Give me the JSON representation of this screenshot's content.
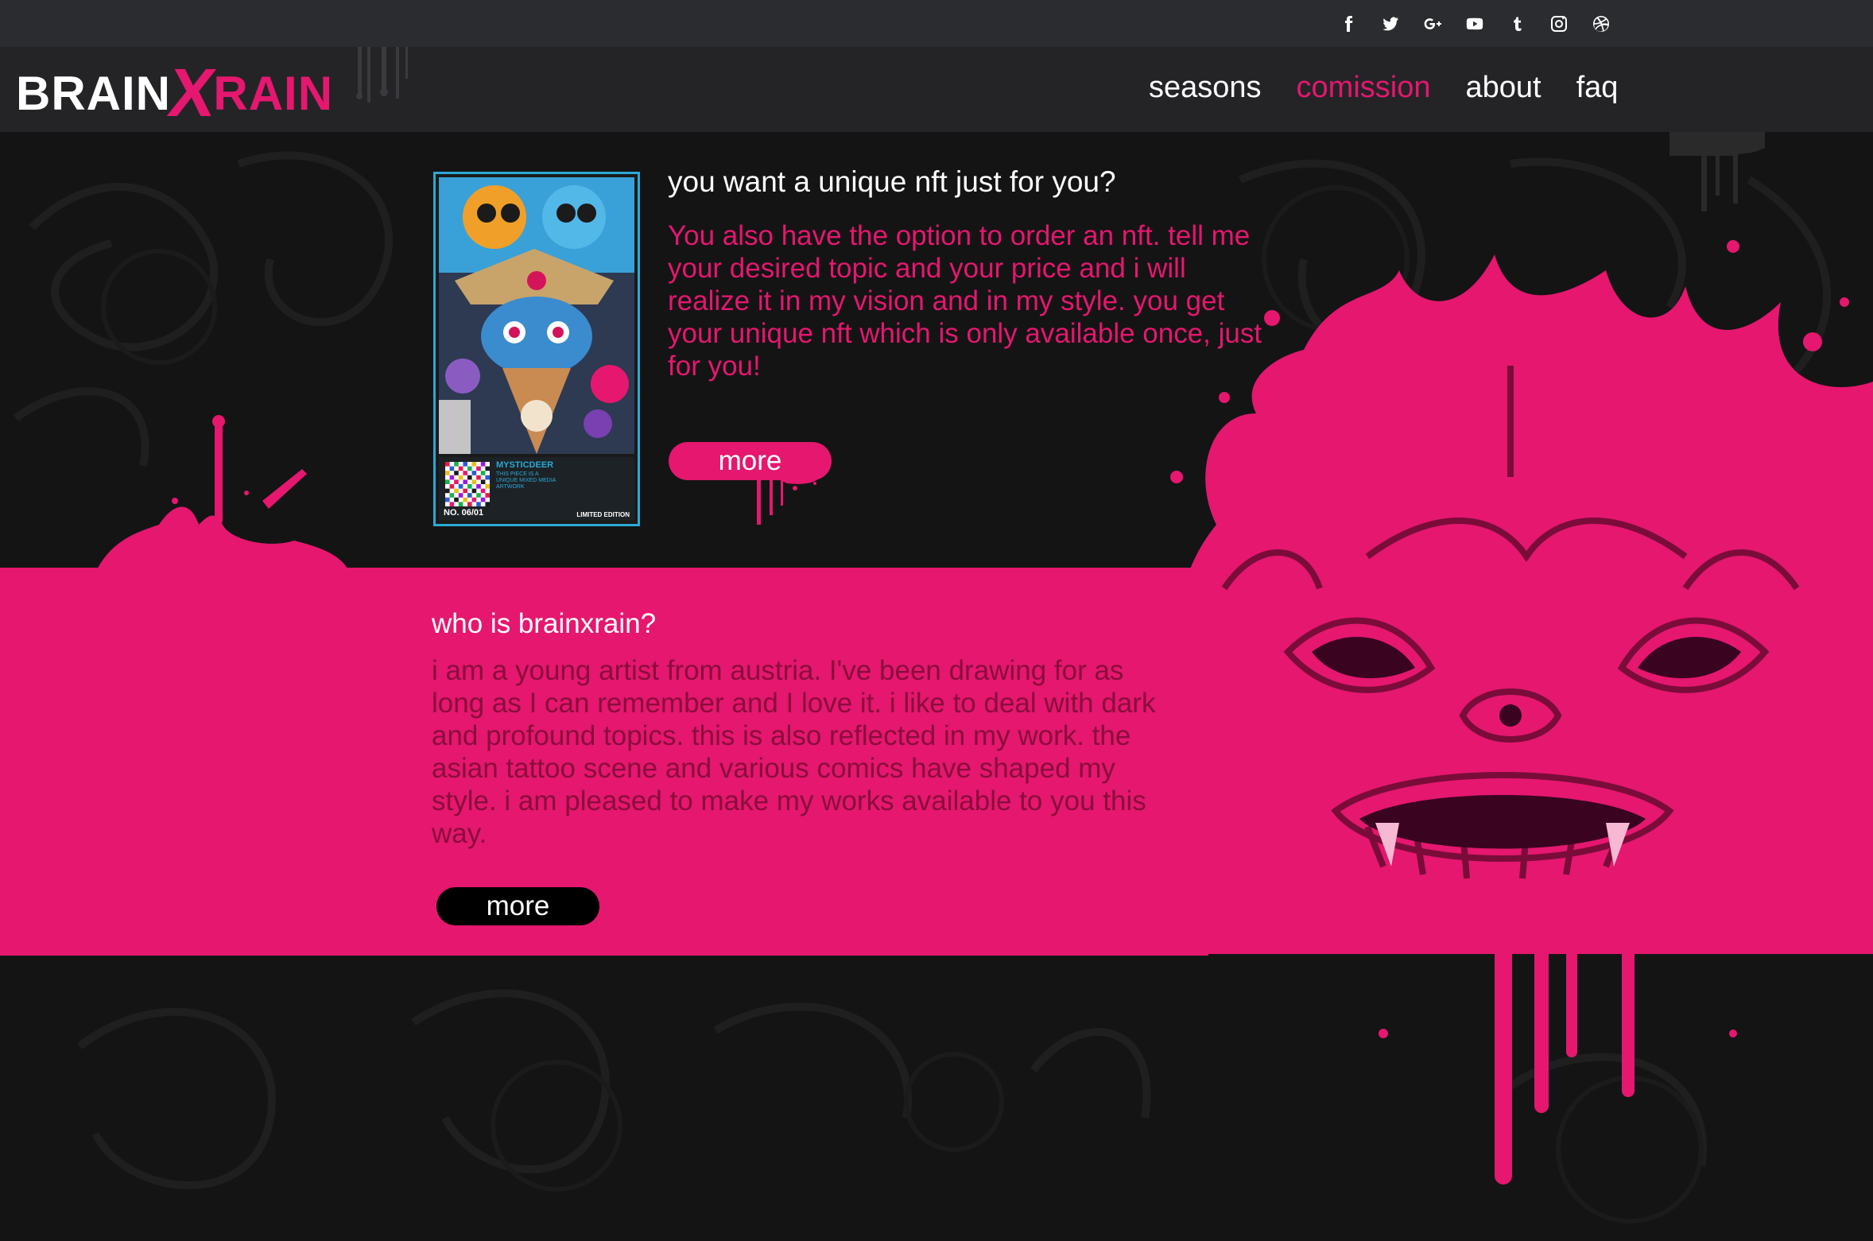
{
  "brand": {
    "logo_part1": "BRAIN",
    "logo_part2": "X",
    "logo_part3": "RAIN",
    "accent_color": "#e5176f",
    "card_color": "#2aa9d6"
  },
  "social": [
    {
      "name": "facebook-icon"
    },
    {
      "name": "twitter-icon"
    },
    {
      "name": "google-plus-icon"
    },
    {
      "name": "youtube-icon"
    },
    {
      "name": "tumblr-icon"
    },
    {
      "name": "instagram-icon"
    },
    {
      "name": "dribbble-icon"
    }
  ],
  "nav": {
    "seasons": "seasons",
    "comission": "comission",
    "about": "about",
    "faq": "faq",
    "active": "comission"
  },
  "commission": {
    "title": "you want a unique nft just for you?",
    "body": "You also have the option to order an nft. tell me your desired topic and your price and i will realize it in my vision and in my style. you get your unique nft which is only available once, just for you!",
    "button": "more",
    "card": {
      "name": "MYSTICDEER",
      "desc": "THIS PIECE IS A UNIQUE MIXED MEDIA ARTWORK",
      "number": "NO. 06/01",
      "edition": "LIMITED EDITION"
    }
  },
  "about": {
    "title": "who is brainxrain?",
    "body": "i am a young artist from austria. I've been drawing for as long as I can remember and I love it. i like to deal with dark and profound topics. this is also reflected in my work. the asian tattoo scene and various comics have shaped my style. i am pleased to make my works available to you this way.",
    "button": "more"
  }
}
